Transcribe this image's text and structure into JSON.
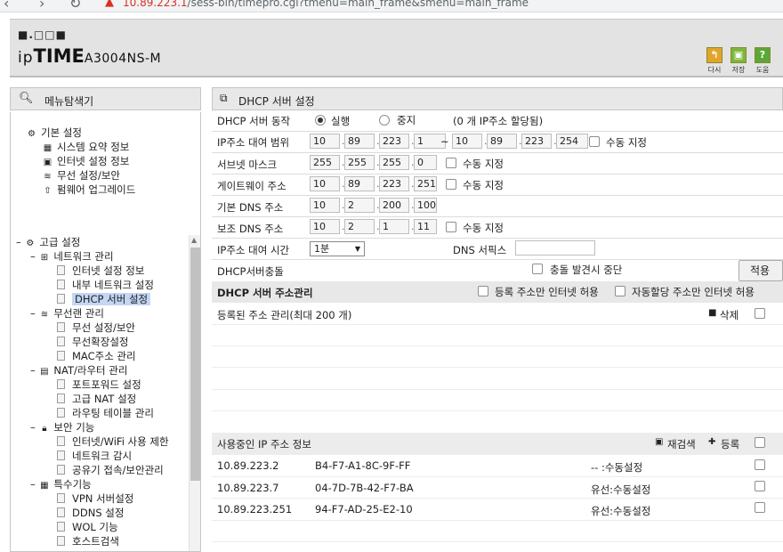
{
  "browser": {
    "url_host": "10.89.223.1",
    "url_rest": "/sess-bin/timepro.cgi?tmenu=main_frame&smenu=main_frame"
  },
  "header": {
    "logo_dots": "■.□□■",
    "logo_ip": "ip",
    "logo_time": "TIME",
    "logo_model": "A3004NS-M",
    "buttons": [
      {
        "label": "다시",
        "color": "#e2a52a",
        "icon": "undo-icon"
      },
      {
        "label": "저장",
        "color": "#7cb83a",
        "icon": "save-icon"
      },
      {
        "label": "도움",
        "color": "#5aa836",
        "icon": "help-icon"
      }
    ]
  },
  "menu": {
    "title": "메뉴탐색기",
    "basic": {
      "label": "기본 설정",
      "items": [
        "시스템 요약 정보",
        "인터넷 설정 정보",
        "무선 설정/보안",
        "펌웨어 업그레이드"
      ]
    },
    "advanced": {
      "label": "고급 설정",
      "groups": [
        {
          "label": "네트워크 관리",
          "items": [
            "인터넷 설정 정보",
            "내부 네트워크 설정",
            "DHCP 서버 설정"
          ]
        },
        {
          "label": "무선랜 관리",
          "items": [
            "무선 설정/보안",
            "무선확장설정",
            "MAC주소 관리"
          ]
        },
        {
          "label": "NAT/라우터 관리",
          "items": [
            "포트포워드 설정",
            "고급 NAT 설정",
            "라우팅 테이블 관리"
          ]
        },
        {
          "label": "보안 기능",
          "items": [
            "인터넷/WiFi 사용 제한",
            "네트워크 감시",
            "공유기 접속/보안관리"
          ]
        },
        {
          "label": "특수기능",
          "items": [
            "VPN 서버설정",
            "DDNS 설정",
            "WOL 기능",
            "호스트검색"
          ]
        }
      ]
    }
  },
  "panel": {
    "title": "DHCP 서버 설정",
    "server": {
      "label": "DHCP 서버 동작",
      "on_label": "실행",
      "off_label": "중지",
      "note": "(0 개 IP주소 할당됨)"
    },
    "range": {
      "label": "IP주소 대여 범위",
      "start": [
        "10",
        "89",
        "223",
        "1"
      ],
      "tilde": "~",
      "end": [
        "10",
        "89",
        "223",
        "254"
      ],
      "manual": "수동 지정"
    },
    "subnet": {
      "label": "서브넷 마스크",
      "value": [
        "255",
        "255",
        "255",
        "0"
      ],
      "manual": "수동 지정"
    },
    "gateway": {
      "label": "게이트웨이 주소",
      "value": [
        "10",
        "89",
        "223",
        "251"
      ],
      "manual": "수동 지정"
    },
    "dns1": {
      "label": "기본 DNS 주소",
      "value": [
        "10",
        "2",
        "200",
        "100"
      ]
    },
    "dns2": {
      "label": "보조 DNS 주소",
      "value": [
        "10",
        "2",
        "1",
        "11"
      ],
      "manual": "수동 지정"
    },
    "lease": {
      "label": "IP주소 대여 시간",
      "value": "1분",
      "suffix_label": "DNS 서픽스",
      "suffix_value": ""
    },
    "conflict": {
      "label": "DHCP서버충돌",
      "option": "충돌 발견시 중단",
      "apply": "적용"
    },
    "addr_mgmt": {
      "title": "DHCP 서버 주소관리",
      "opt1": "등록 주소만 인터넷 허용",
      "opt2": "자동할당 주소만 인터넷 허용"
    },
    "registered": {
      "title": "등록된 주소 관리(최대 200 개)",
      "delete": "삭제"
    },
    "inuse": {
      "title": "사용중인 IP 주소 정보",
      "rescan": "재검색",
      "register": "등록",
      "rows": [
        {
          "ip": "10.89.223.2",
          "mac": "B4-F7-A1-8C-9F-FF",
          "type": "-- :수동설정"
        },
        {
          "ip": "10.89.223.7",
          "mac": "04-7D-7B-42-F7-BA",
          "type": "유선:수동설정"
        },
        {
          "ip": "10.89.223.251",
          "mac": "94-F7-AD-25-E2-10",
          "type": "유선:수동설정"
        }
      ]
    }
  }
}
